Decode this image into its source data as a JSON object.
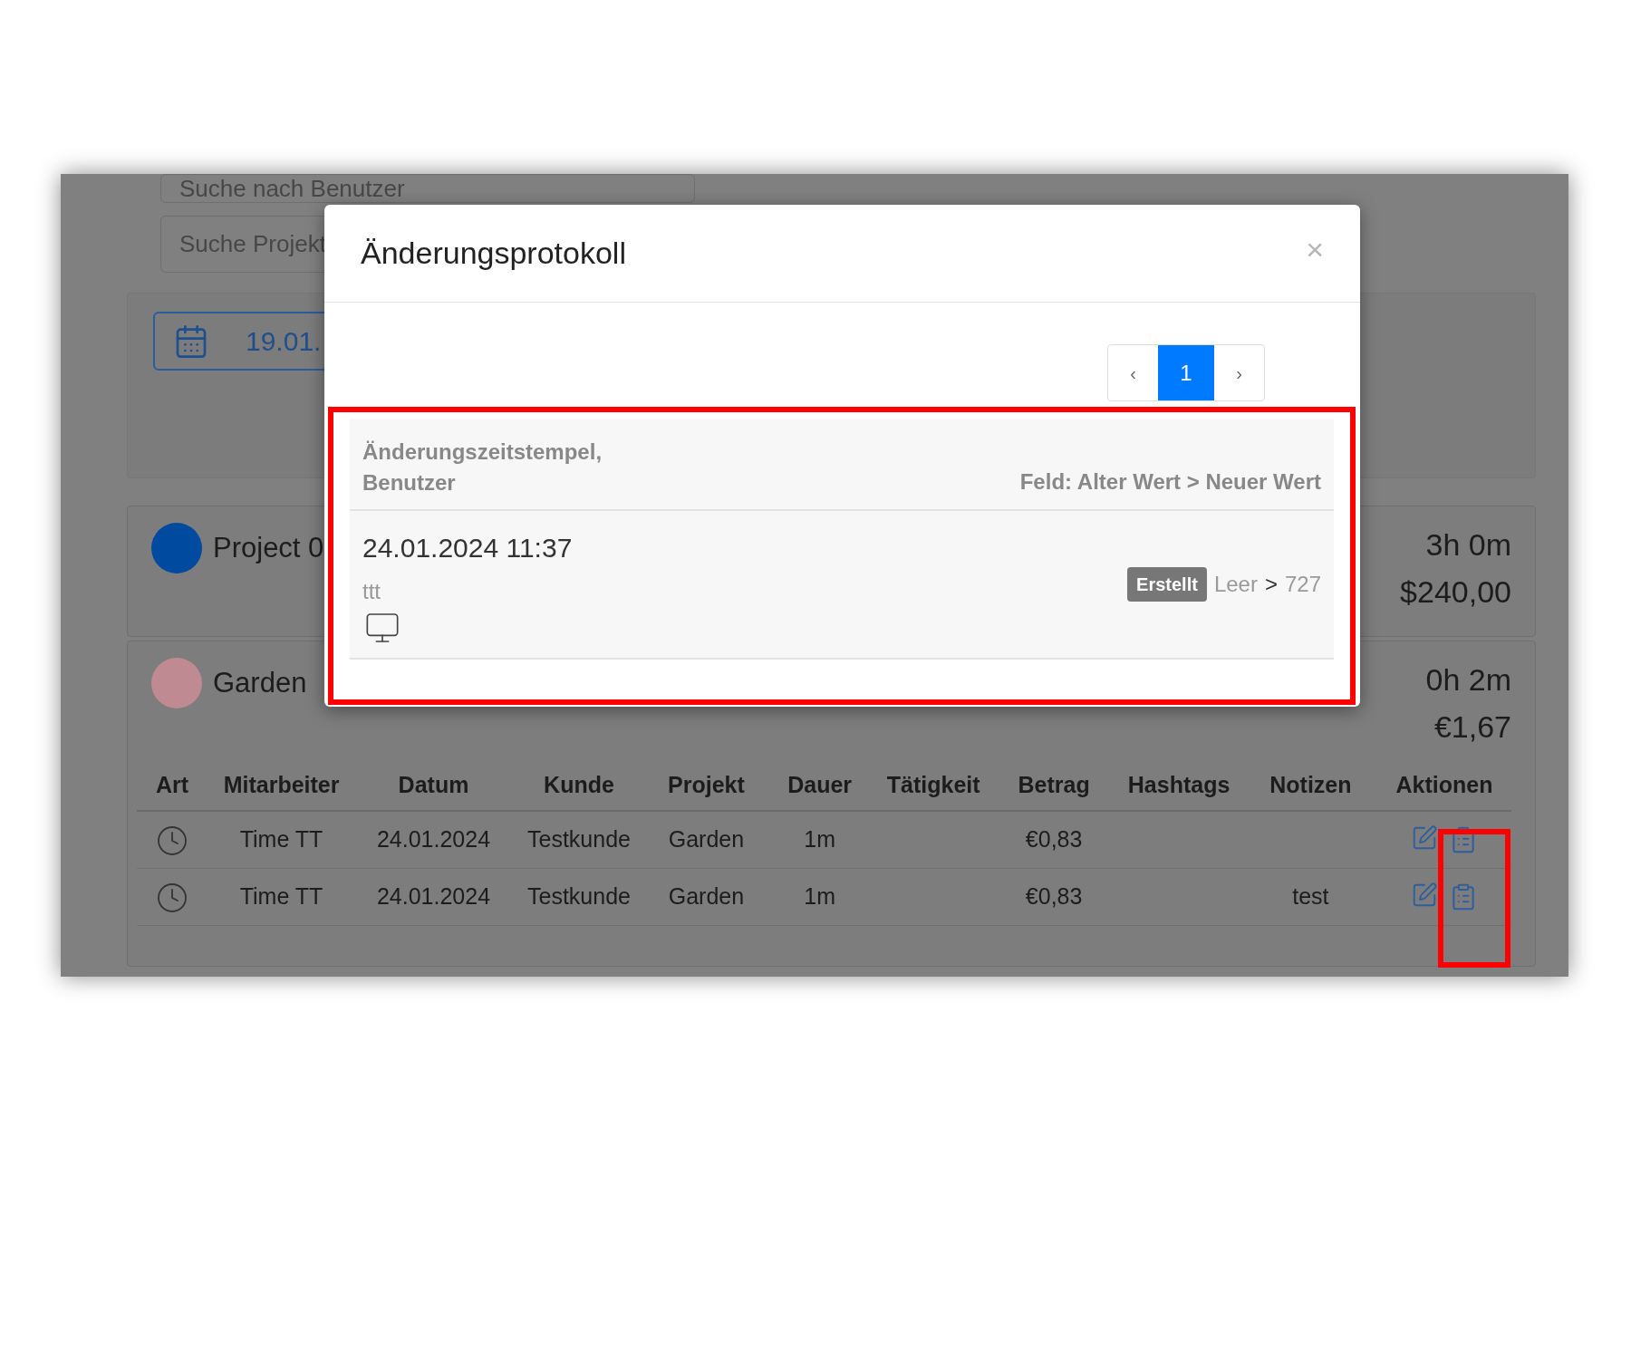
{
  "background": {
    "search_fields": [
      {
        "placeholder": "Suche nach Benutzer"
      },
      {
        "placeholder": "Suche Projekt"
      }
    ],
    "date_field": {
      "value": "19.01."
    },
    "projects": [
      {
        "name": "Project 0",
        "color": "#004a9f",
        "duration": "3h 0m",
        "amount": "$240,00"
      },
      {
        "name": "Garden",
        "color": "#c08a93",
        "duration": "0h 2m",
        "amount": "€1,67"
      }
    ],
    "table": {
      "columns": [
        "Art",
        "Mitarbeiter",
        "Datum",
        "Kunde",
        "Projekt",
        "Dauer",
        "Tätigkeit",
        "Betrag",
        "Hashtags",
        "Notizen",
        "Aktionen"
      ],
      "rows": [
        {
          "employee": "Time TT",
          "date": "24.01.2024",
          "customer": "Testkunde",
          "project": "Garden",
          "duration": "1m",
          "amount": "€0,83"
        },
        {
          "employee": "Time TT",
          "date": "24.01.2024",
          "customer": "Testkunde",
          "project": "Garden",
          "duration": "1m",
          "amount": "€0,83",
          "notes": "test"
        }
      ]
    }
  },
  "modal": {
    "title": "Änderungsprotokoll",
    "close": "×",
    "pagination": {
      "prev": "‹",
      "pages": [
        {
          "label": "1",
          "selected": true
        }
      ],
      "next": "›"
    },
    "log": {
      "header_left": "Änderungszeitstempel, Benutzer",
      "header_right": "Feld: Alter Wert > Neuer Wert",
      "entries": [
        {
          "timestamp": "24.01.2024 11:37",
          "user": "ttt",
          "changes": [
            {
              "badge": "Erstellt",
              "old": "Leer",
              "separator": ">",
              "new": "727"
            }
          ]
        }
      ]
    }
  }
}
